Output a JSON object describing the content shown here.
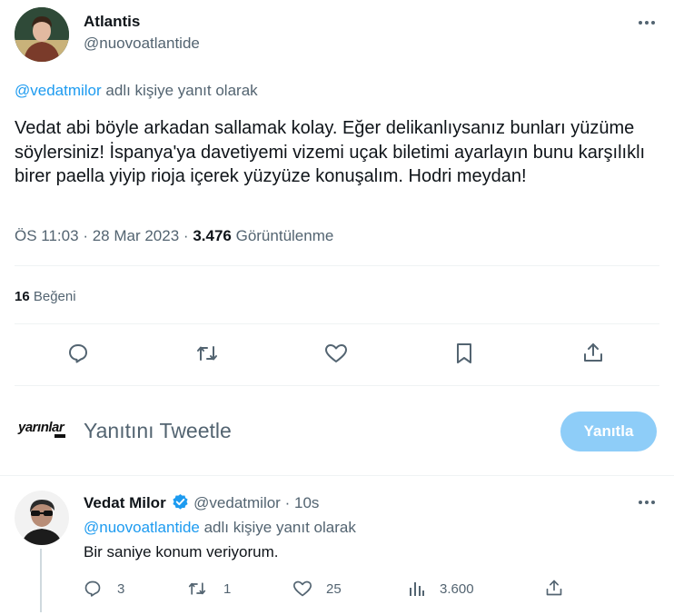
{
  "main_tweet": {
    "display_name": "Atlantis",
    "handle": "@nuovoatlantide",
    "reply_to_mention": "@vedatmilor",
    "reply_to_suffix": " adlı kişiye yanıt olarak",
    "body": "Vedat abi böyle arkadan sallamak kolay. Eğer delikanlıysanız bunları yüzüme söylersiniz! İspanya'ya davetiyemi vizemi uçak biletimi ayarlayın bunu karşılıklı birer paella yiyip rioja içerek yüzyüze konuşalım. Hodri meydan!",
    "time": "ÖS 11:03",
    "dot1": "·",
    "date": "28 Mar 2023",
    "dot2": "·",
    "views_count": "3.476",
    "views_label": "Görüntülenme",
    "likes_count": "16",
    "likes_label": "Beğeni"
  },
  "compose": {
    "logo_text": "yarınlar",
    "placeholder": "Yanıtını Tweetle",
    "reply_button": "Yanıtla"
  },
  "reply_tweet": {
    "display_name": "Vedat Milor",
    "handle": "@vedatmilor",
    "dot": "·",
    "time": "10s",
    "reply_to_mention": "@nuovoatlantide",
    "reply_to_suffix": " adlı kişiye yanıt olarak",
    "body": "Bir saniye konum veriyorum.",
    "reply_count": "3",
    "retweet_count": "1",
    "like_count": "25",
    "views_count": "3.600"
  },
  "colors": {
    "accent": "#1d9bf0",
    "reply_button_disabled": "#8ecdf8",
    "muted_text": "#536471",
    "divider": "#eff3f4"
  }
}
